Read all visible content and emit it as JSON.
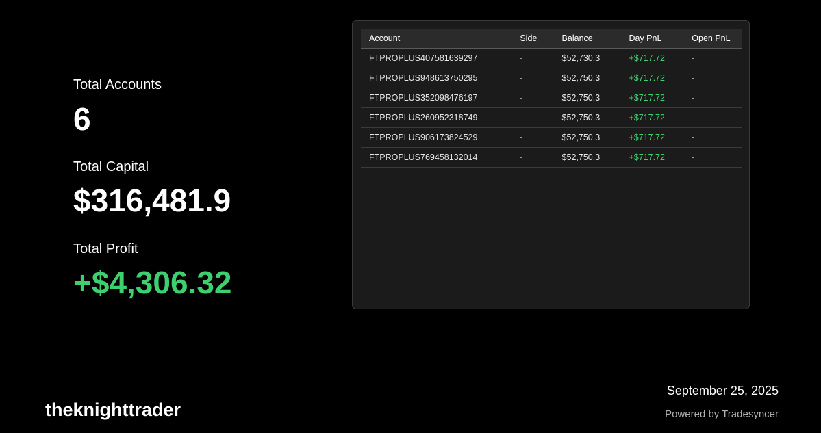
{
  "colors": {
    "background": "#000000",
    "text": "#ffffff",
    "profit": "#3ecf6e",
    "panel": "#1b1b1b",
    "muted": "#9a9a9a"
  },
  "summary": {
    "accounts_label": "Total Accounts",
    "accounts_value": "6",
    "capital_label": "Total Capital",
    "capital_value": "$316,481.9",
    "profit_label": "Total Profit",
    "profit_value": "+$4,306.32"
  },
  "table": {
    "headers": [
      "Account",
      "Side",
      "Balance",
      "Day PnL",
      "Open PnL"
    ],
    "rows": [
      {
        "account": "FTPROPLUS407581639297",
        "side": "-",
        "balance": "$52,730.3",
        "day_pnl": "+$717.72",
        "open_pnl": "-"
      },
      {
        "account": "FTPROPLUS948613750295",
        "side": "-",
        "balance": "$52,750.3",
        "day_pnl": "+$717.72",
        "open_pnl": "-"
      },
      {
        "account": "FTPROPLUS352098476197",
        "side": "-",
        "balance": "$52,750.3",
        "day_pnl": "+$717.72",
        "open_pnl": "-"
      },
      {
        "account": "FTPROPLUS260952318749",
        "side": "-",
        "balance": "$52,750.3",
        "day_pnl": "+$717.72",
        "open_pnl": "-"
      },
      {
        "account": "FTPROPLUS906173824529",
        "side": "-",
        "balance": "$52,750.3",
        "day_pnl": "+$717.72",
        "open_pnl": "-"
      },
      {
        "account": "FTPROPLUS769458132014",
        "side": "-",
        "balance": "$52,750.3",
        "day_pnl": "+$717.72",
        "open_pnl": "-"
      }
    ]
  },
  "footer": {
    "username": "theknighttrader",
    "date": "September 25, 2025",
    "powered_by": "Powered by Tradesyncer"
  }
}
